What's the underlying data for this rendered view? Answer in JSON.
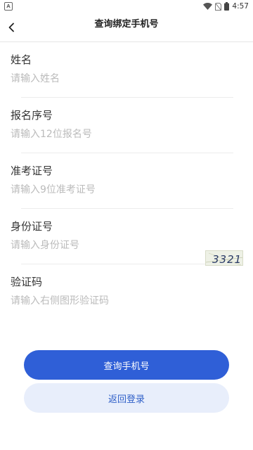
{
  "statusbar": {
    "time": "4:57",
    "app_badge": "A"
  },
  "navbar": {
    "title": "查询绑定手机号"
  },
  "form": {
    "fields": [
      {
        "label": "姓名",
        "placeholder": "请输入姓名"
      },
      {
        "label": "报名序号",
        "placeholder": "请输入12位报名号"
      },
      {
        "label": "准考证号",
        "placeholder": "请输入9位准考证号"
      },
      {
        "label": "身份证号",
        "placeholder": "请输入身份证号"
      },
      {
        "label": "验证码",
        "placeholder": "请输入右侧图形验证码"
      }
    ],
    "captcha_text": "3321"
  },
  "buttons": {
    "query": "查询手机号",
    "back_login": "返回登录"
  },
  "colors": {
    "primary": "#2f5fd7",
    "secondary_bg": "#e8eefb",
    "secondary_text": "#3060c8"
  }
}
